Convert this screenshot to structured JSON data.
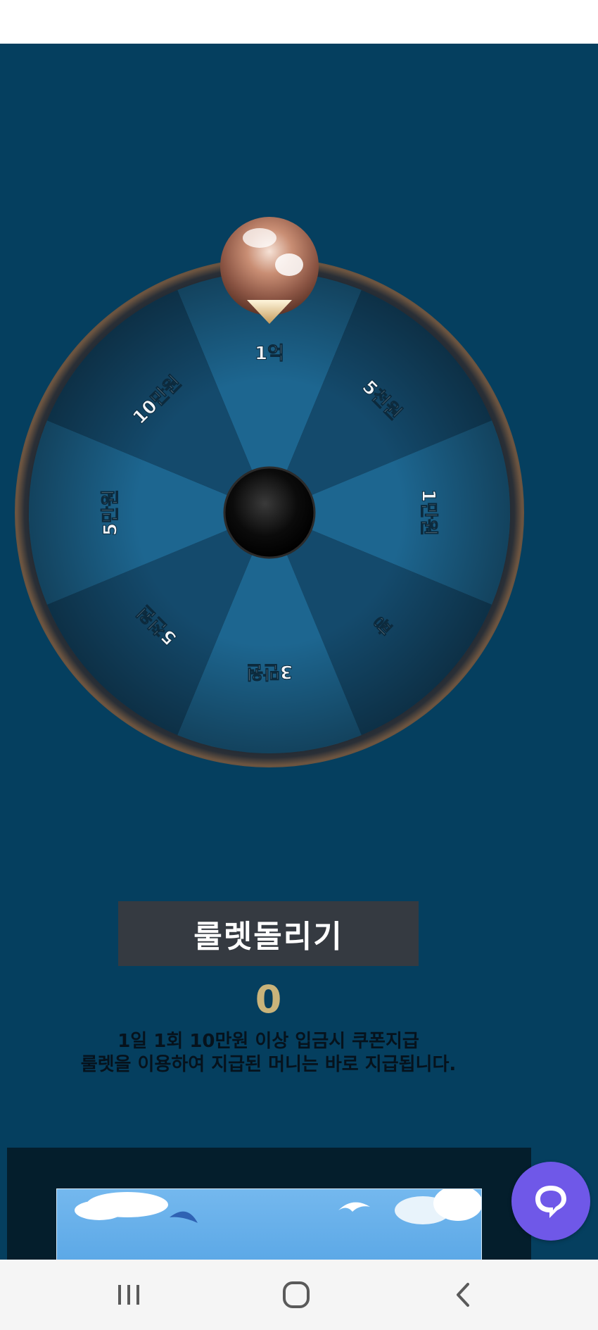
{
  "roulette": {
    "segments": [
      "1억",
      "5천원",
      "1만원",
      "꽝",
      "3만원",
      "5천원",
      "5만원",
      "10만원"
    ],
    "spin_button_label": "룰렛돌리기",
    "result_value": "0",
    "notice_line1": "1일 1회 10만원 이상 입금시 쿠폰지급",
    "notice_line2": "룰렛을 이용하여 지급된 머니는 바로 지급됩니다."
  },
  "colors": {
    "background": "#053f5f",
    "segment_light": "#1d6690",
    "segment_dark": "#144a6c",
    "rim": "#1b2631",
    "button": "#353a41",
    "counter": "#c9b37a",
    "chat": "#6f58e8"
  },
  "icons": {
    "pointer": "bronze-ball-pointer",
    "hub": "black-center-hub",
    "chat": "chat-bubble-icon",
    "nav_recent": "recent-apps-icon",
    "nav_home": "home-icon",
    "nav_back": "back-icon"
  }
}
